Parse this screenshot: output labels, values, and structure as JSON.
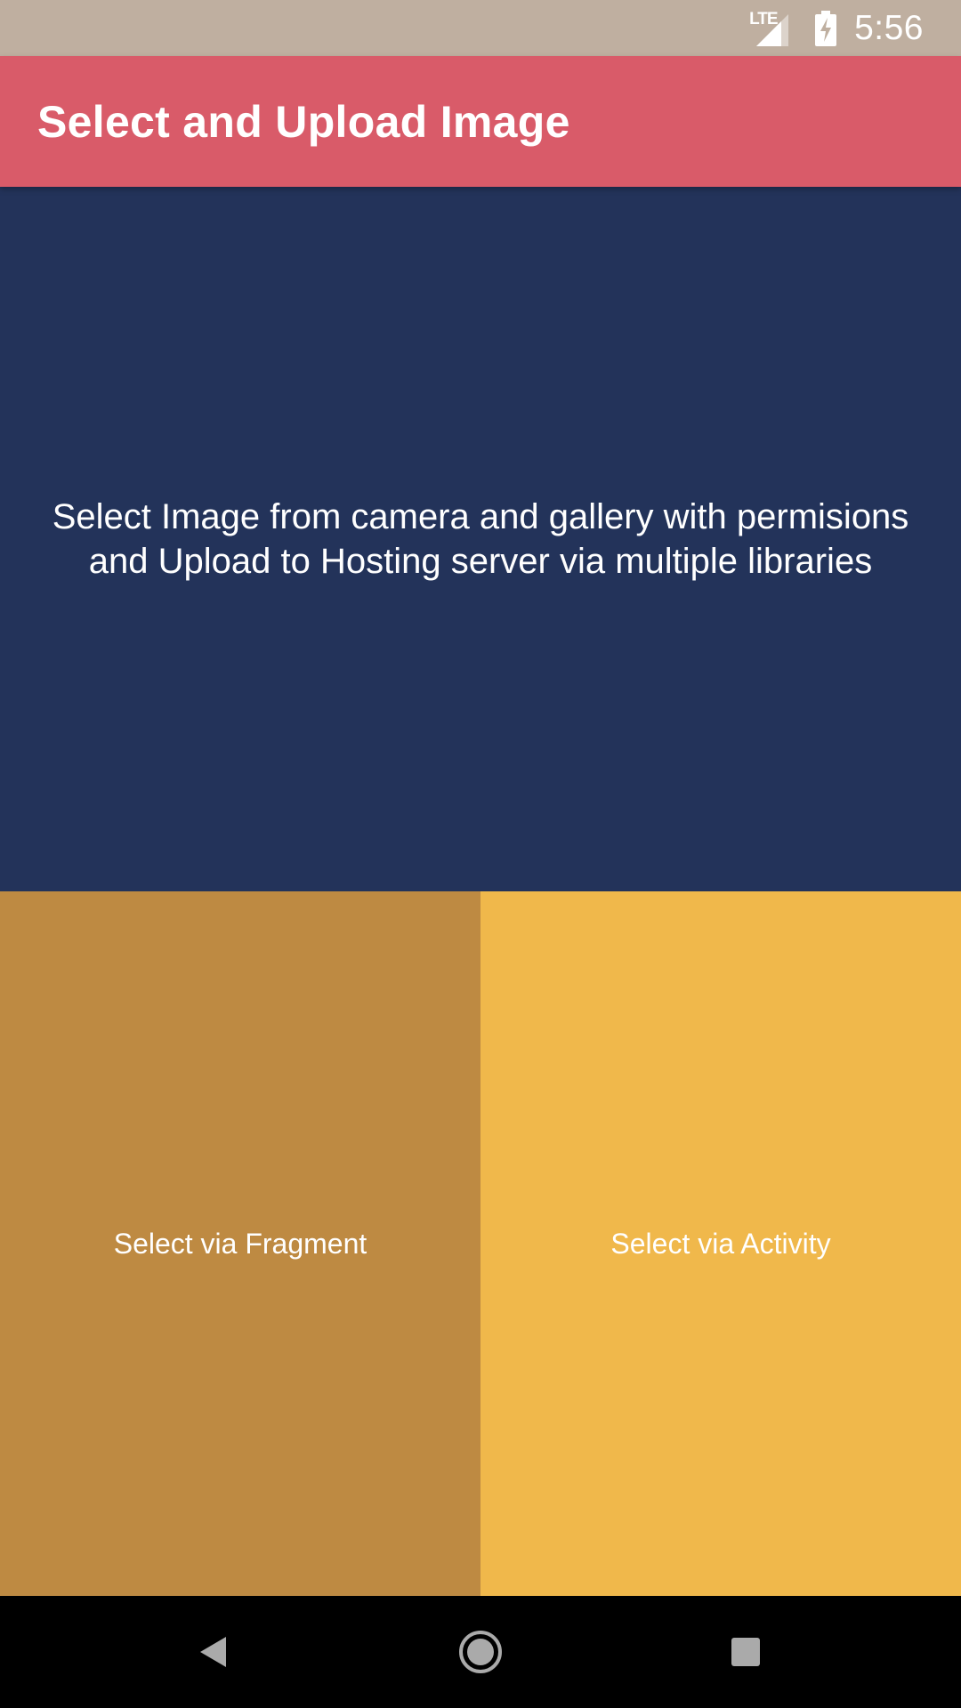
{
  "status_bar": {
    "network": "LTE",
    "time": "5:56",
    "icons": [
      "lte-signal-icon",
      "battery-charging-icon"
    ]
  },
  "app_bar": {
    "title": "Select and Upload Image"
  },
  "hero": {
    "description": "Select Image from camera and gallery with permisions and Upload to Hosting server via multiple libraries"
  },
  "buttons": {
    "fragment_label": "Select via Fragment",
    "activity_label": "Select via Activity"
  },
  "nav_bar": {
    "icons": [
      "back-icon",
      "home-icon",
      "recents-icon"
    ]
  },
  "colors": {
    "status_bar": "#bfafa0",
    "app_bar": "#d95b69",
    "hero": "#23335a",
    "fragment_button": "#be8a42",
    "activity_button": "#f0b84b",
    "nav_bar": "#000000"
  }
}
